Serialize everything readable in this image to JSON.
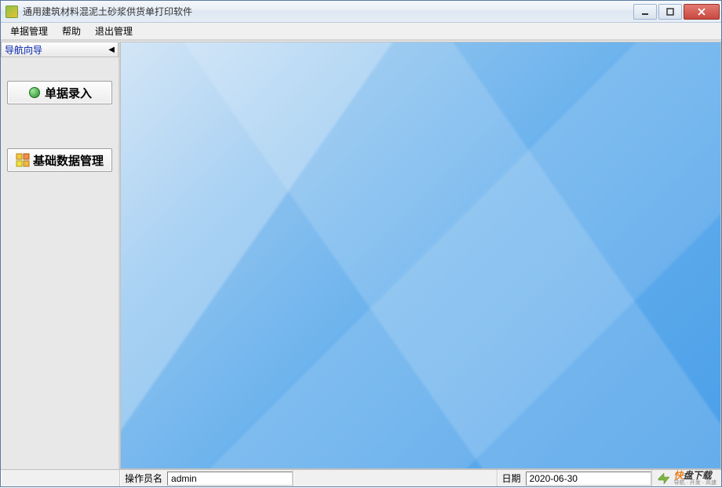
{
  "window": {
    "title": "通用建筑材料混泥土砂浆供货单打印软件"
  },
  "menubar": {
    "items": [
      "单据管理",
      "帮助",
      "退出管理"
    ]
  },
  "sidebar": {
    "nav_header": "导航向导",
    "buttons": [
      {
        "label": "单据录入"
      },
      {
        "label": "基础数据管理"
      }
    ]
  },
  "statusbar": {
    "operator_label": "操作员名",
    "operator_value": "admin",
    "date_label": "日期",
    "date_value": "2020-06-30"
  },
  "watermark": {
    "main_prefix": "快",
    "main_rest": "盘下载",
    "sub": "导航 · 开发 · 高速"
  }
}
